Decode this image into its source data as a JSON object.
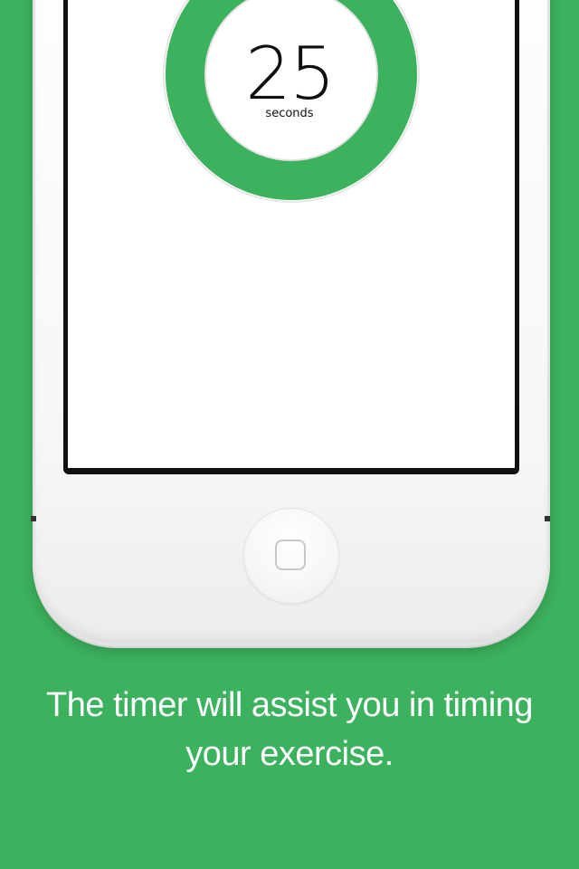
{
  "timer": {
    "value": "25",
    "unit": "seconds",
    "progress_fraction": 0.92,
    "ring_color": "#3cb15e",
    "track_color": "#dcdcdc"
  },
  "caption": {
    "text": "The timer will assist you in timing your exercise."
  },
  "colors": {
    "background": "#3cb15e",
    "phone_body": "#f7f7f7",
    "screen": "#ffffff",
    "bezel": "#111111"
  },
  "icons": {
    "home_button": "home-button-icon"
  }
}
